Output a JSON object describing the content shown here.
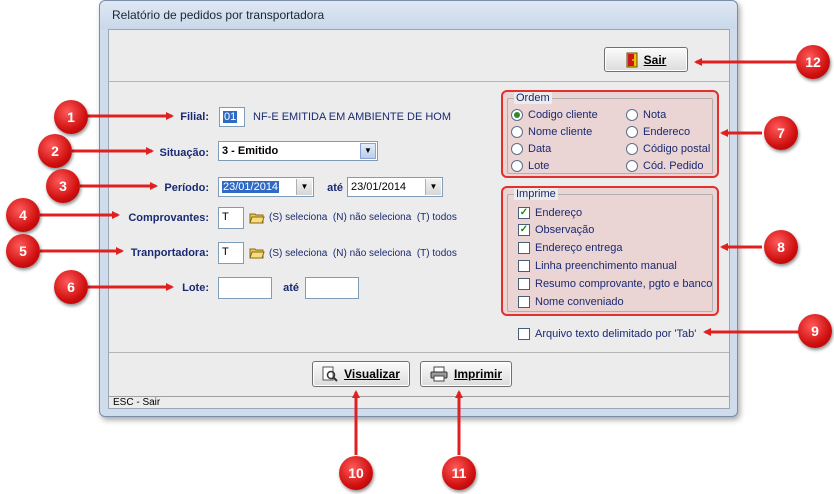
{
  "window": {
    "title": "Relatório de pedidos por transportadora"
  },
  "buttons": {
    "sair": "Sair",
    "visualizar": "Visualizar",
    "imprimir": "Imprimir"
  },
  "form": {
    "filial": {
      "label": "Filial:",
      "value": "01",
      "description": "NF-E EMITIDA EM AMBIENTE DE HOM"
    },
    "situacao": {
      "label": "Situação:",
      "value": "3 - Emitido"
    },
    "periodo": {
      "label": "Período:",
      "from": "23/01/2014",
      "to_label": "até",
      "to": "23/01/2014"
    },
    "comprovantes": {
      "label": "Comprovantes:",
      "value": "T",
      "hint": "(S) seleciona  (N) não seleciona  (T) todos"
    },
    "transportadora": {
      "label": "Tranportadora:",
      "value": "T",
      "hint": "(S) seleciona  (N) não seleciona  (T) todos"
    },
    "lote": {
      "label": "Lote:",
      "from": "",
      "to_label": "até",
      "to": ""
    }
  },
  "ordem": {
    "title": "Ordem",
    "options": [
      "Codigo cliente",
      "Nome cliente",
      "Data",
      "Lote",
      "Nota",
      "Endereco",
      "Código postal",
      "Cód. Pedido"
    ],
    "selected": "Codigo cliente"
  },
  "imprime": {
    "title": "Imprime",
    "options": [
      {
        "label": "Endereço",
        "checked": true
      },
      {
        "label": "Observação",
        "checked": true
      },
      {
        "label": "Endereço entrega",
        "checked": false
      },
      {
        "label": "Linha preenchimento manual",
        "checked": false
      },
      {
        "label": "Resumo comprovante, pgto e banco",
        "checked": false
      },
      {
        "label": "Nome conveniado",
        "checked": false
      }
    ]
  },
  "arquivo_texto": {
    "label": "Arquivo texto delimitado por 'Tab'",
    "checked": false
  },
  "status": {
    "text": "ESC - Sair"
  },
  "badges": [
    "1",
    "2",
    "3",
    "4",
    "5",
    "6",
    "7",
    "8",
    "9",
    "10",
    "11",
    "12"
  ],
  "colors": {
    "accent": "#1a2a72",
    "badge": "#d01010",
    "arrow": "#e02020",
    "highlight": "#e03030"
  },
  "icons": [
    "door-exit-icon",
    "magnifier-icon",
    "printer-icon",
    "folder-open-icon",
    "chevron-down-icon"
  ]
}
